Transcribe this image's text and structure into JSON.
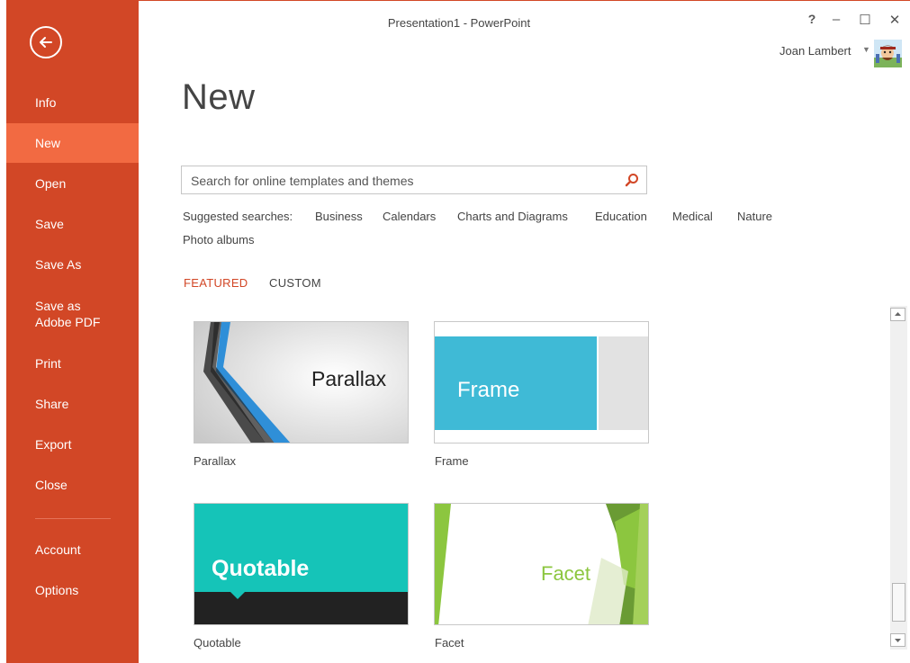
{
  "window": {
    "title": "Presentation1 - PowerPoint",
    "help": "?",
    "minimize": "–",
    "maximize": "☐",
    "close": "✕"
  },
  "user": {
    "name": "Joan Lambert",
    "caret": "▼"
  },
  "colors": {
    "accent": "#d24726",
    "active_nav": "#f26a42"
  },
  "sidebar": {
    "back_icon": "back-arrow-icon",
    "items": [
      {
        "label": "Info"
      },
      {
        "label": "New"
      },
      {
        "label": "Open"
      },
      {
        "label": "Save"
      },
      {
        "label": "Save As"
      },
      {
        "label": "Save as Adobe PDF"
      },
      {
        "label": "Print"
      },
      {
        "label": "Share"
      },
      {
        "label": "Export"
      },
      {
        "label": "Close"
      },
      {
        "label": "Account"
      },
      {
        "label": "Options"
      }
    ]
  },
  "main": {
    "title": "New",
    "search": {
      "placeholder": "Search for online templates and themes",
      "value": ""
    },
    "suggested_label": "Suggested searches:",
    "suggested": [
      "Business",
      "Calendars",
      "Charts and Diagrams",
      "Education",
      "Medical",
      "Nature",
      "Photo albums"
    ],
    "tabs": [
      {
        "label": "FEATURED",
        "active": true
      },
      {
        "label": "CUSTOM",
        "active": false
      }
    ],
    "templates": [
      {
        "name": "Parallax",
        "thumb_text": "Parallax"
      },
      {
        "name": "Frame",
        "thumb_text": "Frame"
      },
      {
        "name": "Quotable",
        "thumb_text": "Quotable"
      },
      {
        "name": "Facet",
        "thumb_text": "Facet"
      }
    ]
  }
}
